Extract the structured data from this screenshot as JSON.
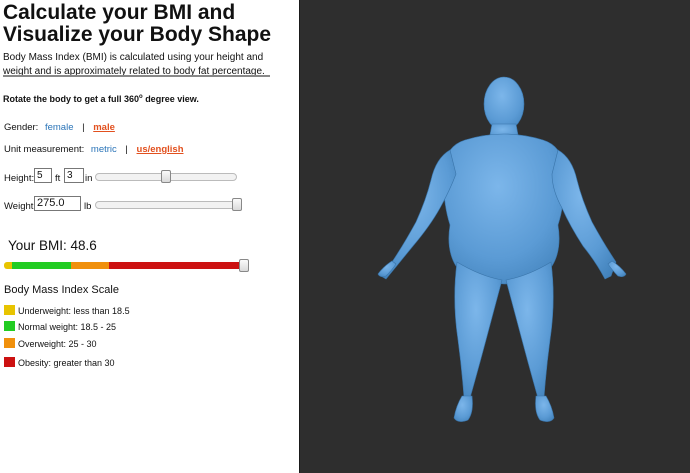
{
  "header": {
    "title": "Calculate your BMI and Visualize your Body Shape",
    "intro": "Body Mass Index (BMI) is calculated using your height and weight and is approximately related to body fat percentage.",
    "rotate_note_prefix": "Rotate the body to get a full 360",
    "rotate_note_sup": "o",
    "rotate_note_suffix": " degree view."
  },
  "gender": {
    "label": "Gender:",
    "options": [
      "female",
      "male"
    ],
    "selected": "male",
    "separator": "|"
  },
  "units": {
    "label": "Unit measurement:",
    "options": [
      "metric",
      "us/english"
    ],
    "selected": "us/english",
    "separator": "|"
  },
  "height": {
    "label": "Height:",
    "feet": "5",
    "feet_unit": "ft",
    "inches": "3",
    "inches_unit": "in",
    "slider_fraction": 0.5
  },
  "weight": {
    "label": "Weight:",
    "value": "275.0",
    "unit": "lb",
    "slider_fraction": 1.0
  },
  "bmi": {
    "label": "Your BMI: 48.6",
    "value": 48.6
  },
  "scale": {
    "title": "Body Mass Index Scale",
    "categories": [
      {
        "label": "Underweight: less than 18.5",
        "color": "#e8c400"
      },
      {
        "label": "Normal weight: 18.5 - 25",
        "color": "#22cc22"
      },
      {
        "label": "Overweight: 25 - 30",
        "color": "#f0900c"
      },
      {
        "label": "Obesity: greater than 30",
        "color": "#cc1111"
      }
    ]
  },
  "viewer": {
    "background": "#2e2e2e",
    "body_color": "#5b9bd5"
  }
}
